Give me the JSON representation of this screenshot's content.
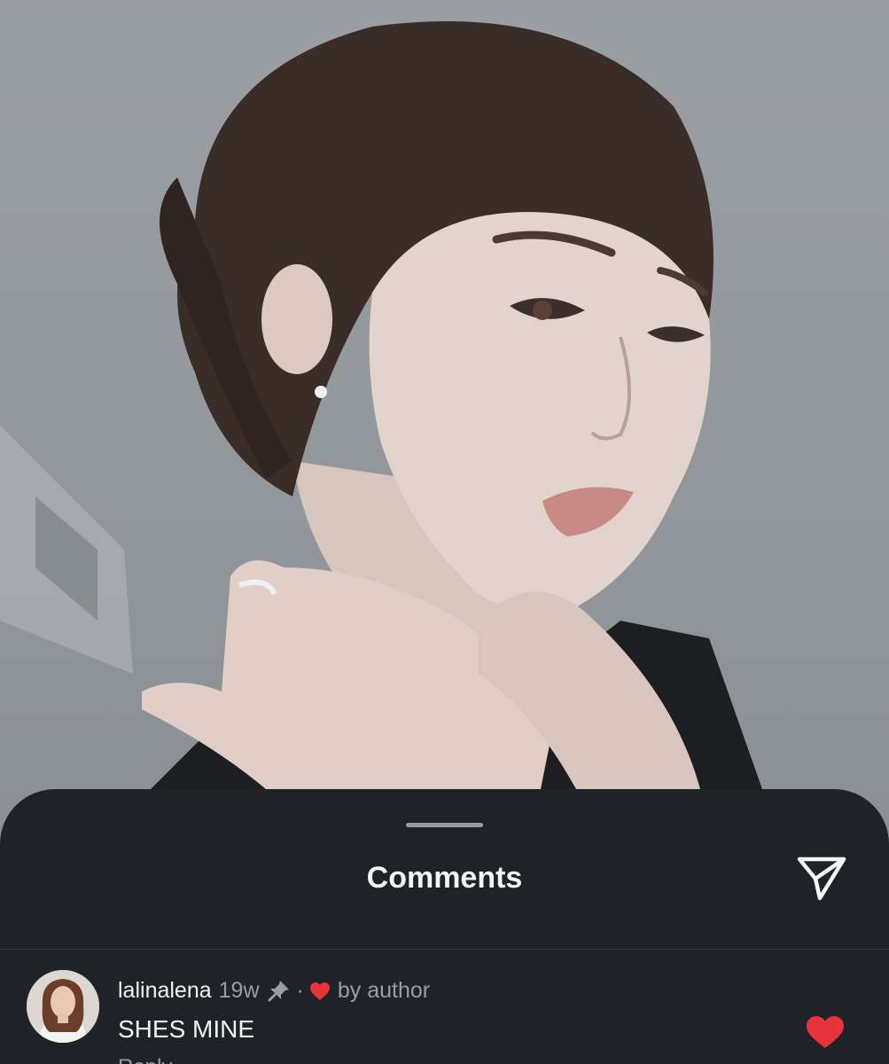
{
  "sheet": {
    "title": "Comments",
    "share_icon": "send-icon"
  },
  "comment": {
    "username": "lalinalena",
    "time": "19w",
    "pin_icon": "pin-icon",
    "separator": "·",
    "by_author": "by author",
    "text": "SHES MINE",
    "reply_label": "Reply",
    "liked_by_author_icon": "heart-icon",
    "like_icon": "heart-icon",
    "liked": true
  },
  "colors": {
    "sheet_background": "#1f2226",
    "heart": "#e8323c",
    "primary_text": "#f2f2f2",
    "secondary_text": "#9a9ea3"
  }
}
